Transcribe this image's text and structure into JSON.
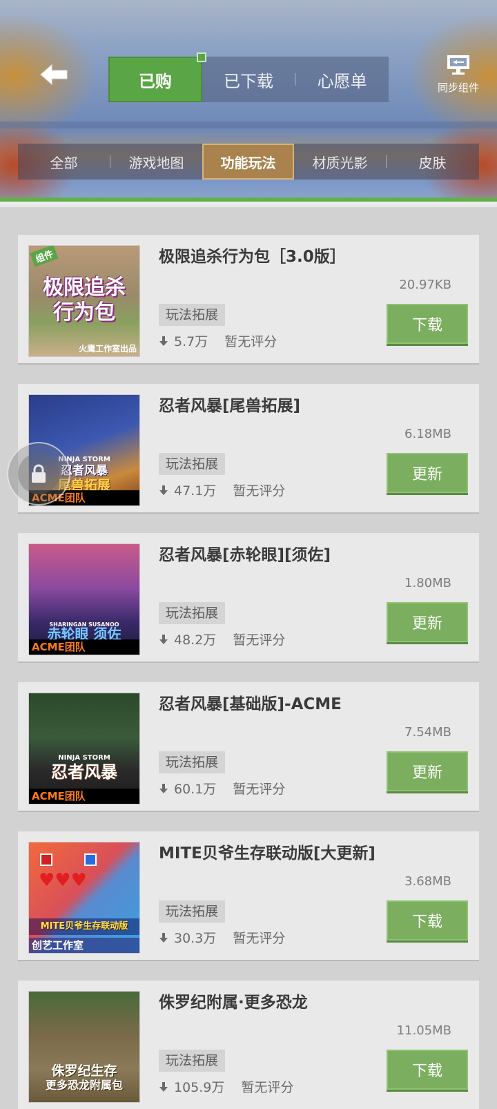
{
  "header": {
    "back_icon": "back-arrow-icon",
    "tabs": [
      {
        "label": "已购",
        "active": true
      },
      {
        "label": "已下载",
        "active": false
      },
      {
        "label": "心愿单",
        "active": false
      }
    ],
    "sync_label": "同步组件",
    "sync_icon": "monitor-sync-icon"
  },
  "categories": [
    {
      "label": "全部",
      "active": false
    },
    {
      "label": "游戏地图",
      "active": false
    },
    {
      "label": "功能玩法",
      "active": true
    },
    {
      "label": "材质光影",
      "active": false
    },
    {
      "label": "皮肤",
      "active": false
    }
  ],
  "colors": {
    "accent_green": "#5aa545",
    "button_green": "#7bae5f",
    "active_category": "#a9824d"
  },
  "items": [
    {
      "title": "极限追杀行为包［3.0版］",
      "size": "20.97KB",
      "tag": "玩法拓展",
      "downloads": "5.7万",
      "rating": "暂无评分",
      "action": "下载",
      "thumb": {
        "line1": "极限追杀",
        "line2": "行为包",
        "badge": "组件",
        "footer": "火鹰工作室出品"
      }
    },
    {
      "title": "忍者风暴[尾兽拓展]",
      "size": "6.18MB",
      "tag": "玩法拓展",
      "downloads": "47.1万",
      "rating": "暂无评分",
      "action": "更新",
      "thumb": {
        "top": "NINJA STORM",
        "line1": "忍者风暴",
        "line2": "尾兽拓展",
        "footer": "ACME团队"
      }
    },
    {
      "title": "忍者风暴[赤轮眼][须佐]",
      "size": "1.80MB",
      "tag": "玩法拓展",
      "downloads": "48.2万",
      "rating": "暂无评分",
      "action": "更新",
      "thumb": {
        "top": "SHARINGAN SUSANOO",
        "line1": "赤轮眼 须佐",
        "footer": "ACME团队"
      }
    },
    {
      "title": "忍者风暴[基础版]-ACME",
      "size": "7.54MB",
      "tag": "玩法拓展",
      "downloads": "60.1万",
      "rating": "暂无评分",
      "action": "更新",
      "thumb": {
        "top": "NINJA STORM",
        "line1": "忍者风暴",
        "footer": "ACME团队"
      }
    },
    {
      "title": "MITE贝爷生存联动版[大更新]",
      "size": "3.68MB",
      "tag": "玩法拓展",
      "downloads": "30.3万",
      "rating": "暂无评分",
      "action": "下载",
      "thumb": {
        "line1": "MITE贝爷生存联动版",
        "footer": "创艺工作室"
      }
    },
    {
      "title": "侏罗纪附属·更多恐龙",
      "size": "11.05MB",
      "tag": "玩法拓展",
      "downloads": "105.9万",
      "rating": "暂无评分",
      "action": "下载",
      "thumb": {
        "line1": "侏罗纪生存",
        "line2": "更多恐龙附属包"
      }
    }
  ]
}
